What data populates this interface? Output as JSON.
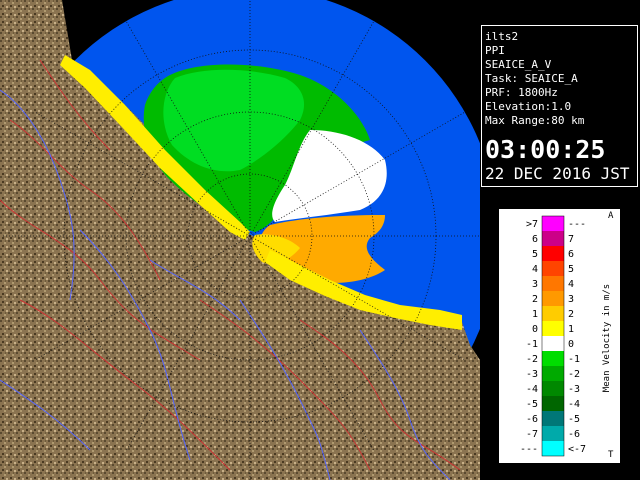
{
  "info": {
    "lines": [
      "ilts2",
      "PPI",
      "SEAICE_A_V",
      "Task: SEAICE_A",
      "PRF: 1800Hz",
      "Elevation:1.0",
      "Max Range:80 km"
    ],
    "time": "03:00:25",
    "date": "22 DEC 2016 JST"
  },
  "legend": {
    "title": "Mean Velocity in m/s",
    "top_letter": "A",
    "bottom_letter": "T",
    "bins": [
      {
        "left": ">7",
        "right": "---",
        "color": "#ff00ff"
      },
      {
        "left": "6",
        "right": "7",
        "color": "#cc0088"
      },
      {
        "left": "5",
        "right": "6",
        "color": "#ff0000"
      },
      {
        "left": "4",
        "right": "5",
        "color": "#ff4400"
      },
      {
        "left": "3",
        "right": "4",
        "color": "#ff7700"
      },
      {
        "left": "2",
        "right": "3",
        "color": "#ff9900"
      },
      {
        "left": "1",
        "right": "2",
        "color": "#ffcc00"
      },
      {
        "left": "0",
        "right": "1",
        "color": "#ffff00"
      },
      {
        "left": "-1",
        "right": "0",
        "color": "#ffffff"
      },
      {
        "left": "-2",
        "right": "-1",
        "color": "#00dd00"
      },
      {
        "left": "-3",
        "right": "-2",
        "color": "#00aa00"
      },
      {
        "left": "-4",
        "right": "-3",
        "color": "#008800"
      },
      {
        "left": "-5",
        "right": "-4",
        "color": "#006600"
      },
      {
        "left": "-6",
        "right": "-5",
        "color": "#007777"
      },
      {
        "left": "-7",
        "right": "-6",
        "color": "#00aaaa"
      },
      {
        "left": "---",
        "right": "<-7",
        "color": "#00ffff"
      }
    ]
  },
  "colors": {
    "sea": "#0055ee",
    "land": "#8a7350",
    "background": "#000000"
  }
}
